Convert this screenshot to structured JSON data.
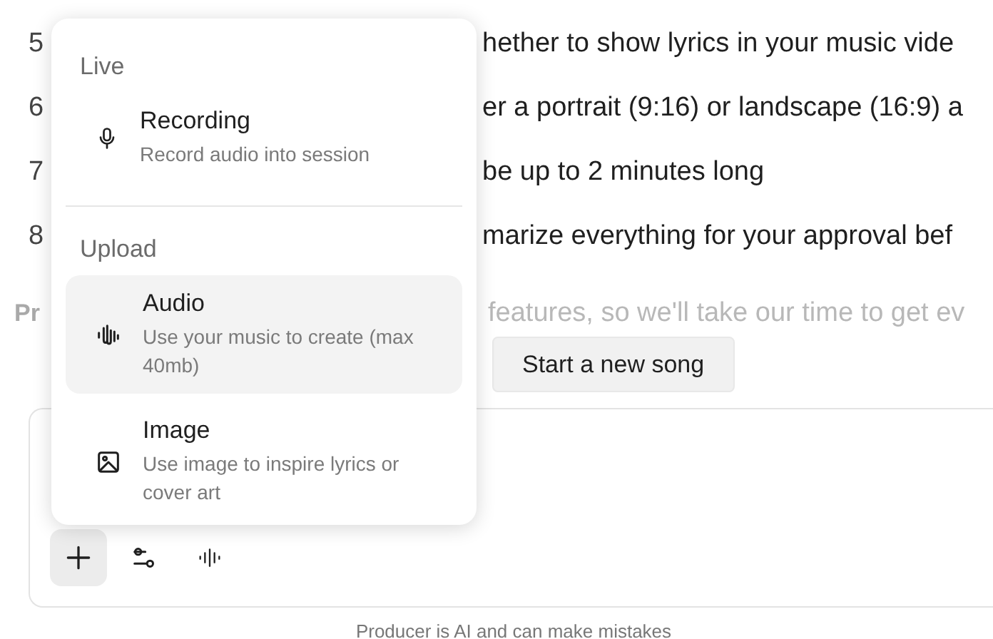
{
  "list_lines": [
    {
      "number": "5",
      "text": "hether to show lyrics in your music vide"
    },
    {
      "number": "6",
      "text": "er a portrait (9:16) or landscape (16:9) a"
    },
    {
      "number": "7",
      "text": "be up to 2 minutes long"
    },
    {
      "number": "8",
      "text": "marize everything for your approval bef"
    }
  ],
  "faded_line": {
    "lead": "Pr",
    "text": "features, so we'll take our time to get ev"
  },
  "suggestion_button": "Start a new song",
  "composer": {
    "tools": [
      {
        "kind": "add",
        "selected": true
      },
      {
        "kind": "settings",
        "selected": false
      },
      {
        "kind": "waveform",
        "selected": false
      }
    ]
  },
  "footer": "Producer is AI and can make mistakes",
  "attach_menu": {
    "sections": [
      {
        "title": "Live",
        "items": [
          {
            "kind": "microphone",
            "label": "Recording",
            "description": "Record audio into session",
            "highlighted": false
          }
        ]
      },
      {
        "title": "Upload",
        "items": [
          {
            "kind": "audio",
            "label": "Audio",
            "description": "Use your music to create (max 40mb)",
            "highlighted": true
          },
          {
            "kind": "image",
            "label": "Image",
            "description": "Use image to inspire lyrics or cover art",
            "highlighted": false
          }
        ]
      }
    ]
  }
}
